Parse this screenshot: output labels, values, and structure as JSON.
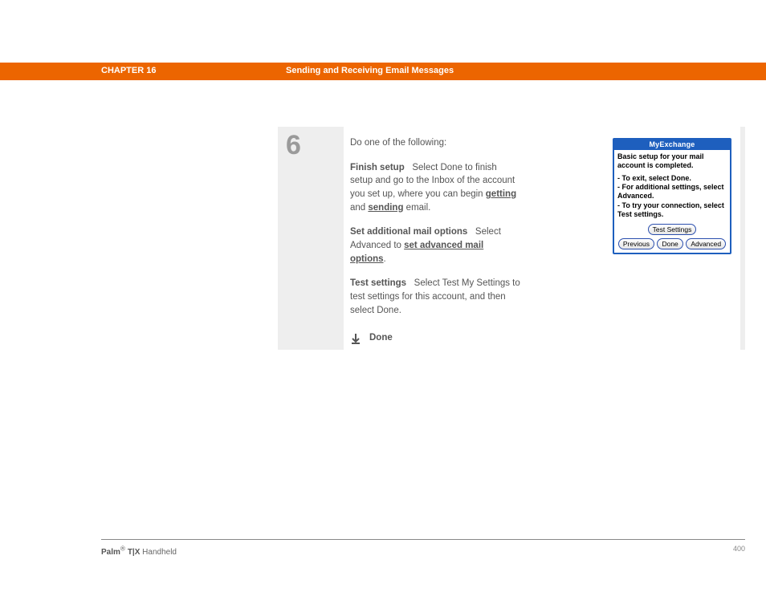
{
  "header": {
    "chapter": "CHAPTER 16",
    "title": "Sending and Receiving Email Messages"
  },
  "step": {
    "number": "6",
    "intro": "Do one of the following:",
    "finish": {
      "label": "Finish setup",
      "pre": "Select Done to finish setup and go to the Inbox of the account you set up, where you can begin ",
      "link1": "getting",
      "mid": " and ",
      "link2": "sending",
      "post": " email."
    },
    "options": {
      "label": "Set additional mail options",
      "pre": "Select Advanced to ",
      "link": "set advanced mail options",
      "post": "."
    },
    "test": {
      "label": "Test settings",
      "text": "Select Test My Settings to test settings for this account, and then select Done."
    },
    "done": "Done"
  },
  "device": {
    "title": "MyExchange",
    "line1": "Basic setup for your mail account is completed.",
    "opt1": "- To exit, select Done.",
    "opt2": "- For additional settings, select Advanced.",
    "opt3": "- To try your connection, select Test settings.",
    "btn_test": "Test Settings",
    "btn_prev": "Previous",
    "btn_done": "Done",
    "btn_adv": "Advanced"
  },
  "footer": {
    "brand_bold": "Palm",
    "brand_sup": "®",
    "brand_model": " T|X",
    "brand_rest": " Handheld",
    "page": "400"
  }
}
